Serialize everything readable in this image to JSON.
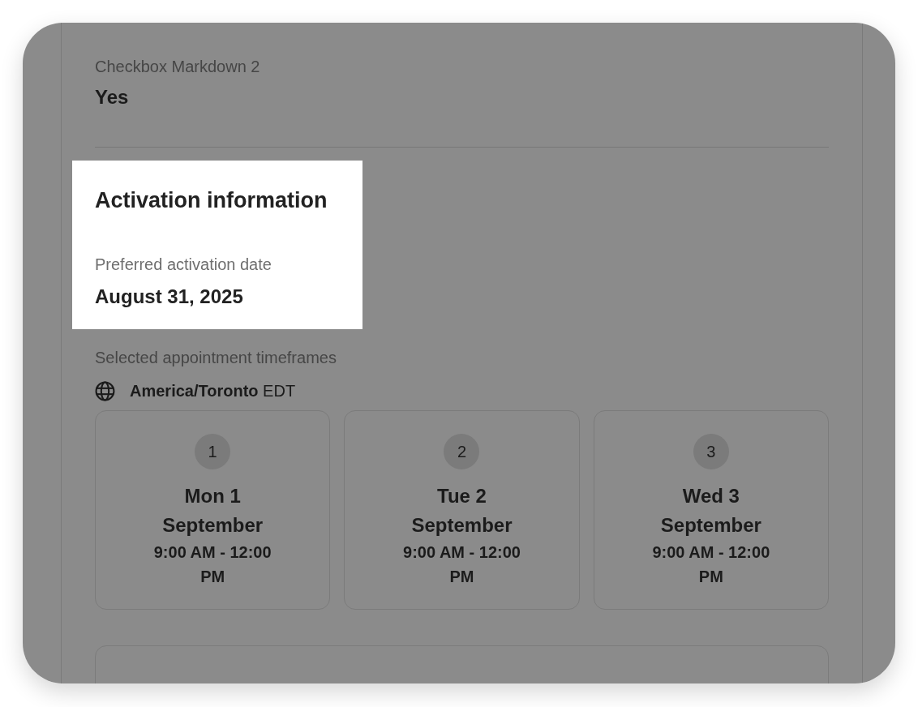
{
  "fields": [
    {
      "label": "Checkbox Markdown 2",
      "value": "Yes"
    }
  ],
  "activation": {
    "title": "Activation information",
    "highlighted": true,
    "fields": [
      {
        "label": "Preferred activation date",
        "value": "August 31, 2025"
      }
    ]
  },
  "appointments": {
    "label": "Selected appointment timeframes",
    "timezone": "**America/Toronto** EDT",
    "slots": [
      {
        "number": "1",
        "date": "Mon 1 September",
        "time": "9:00 AM - 12:00 PM"
      },
      {
        "number": "2",
        "date": "Tue 2 September",
        "time": "9:00 AM - 12:00 PM"
      },
      {
        "number": "3",
        "date": "Wed 3 September",
        "time": "9:00 AM - 12:00 PM"
      }
    ]
  }
}
